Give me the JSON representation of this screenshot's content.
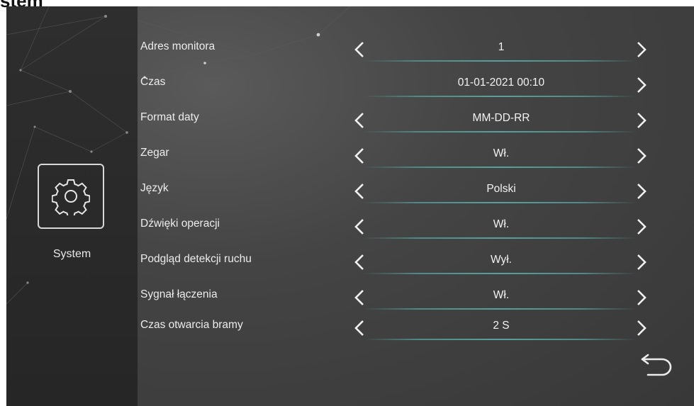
{
  "header": {
    "title": "stem"
  },
  "sidebar": {
    "icon": "gear-icon",
    "label": "System"
  },
  "settings": [
    {
      "label": "Adres monitora",
      "value": "1",
      "has_left": true
    },
    {
      "label": "Czas",
      "value": "01-01-2021  00:10",
      "has_left": false
    },
    {
      "label": "Format daty",
      "value": "MM-DD-RR",
      "has_left": true
    },
    {
      "label": "Zegar",
      "value": "Wł.",
      "has_left": true
    },
    {
      "label": "Język",
      "value": "Polski",
      "has_left": true
    },
    {
      "label": "Dźwięki operacji",
      "value": "Wł.",
      "has_left": true
    },
    {
      "label": "Podgląd detekcji ruchu",
      "value": "Wył.",
      "has_left": true
    },
    {
      "label": "Sygnał łączenia",
      "value": "Wł.",
      "has_left": true
    },
    {
      "label": "Czas otwarcia bramy",
      "value": "2 S",
      "has_left": true
    }
  ],
  "icons": {
    "left": "chevron-left-icon",
    "right": "chevron-right-icon",
    "back": "back-arrow-icon"
  },
  "colors": {
    "text": "#ececec",
    "underline_accent": "#5aa09a",
    "sidebar_bg": "#2a2a2a",
    "panel_bg": "#454545"
  }
}
